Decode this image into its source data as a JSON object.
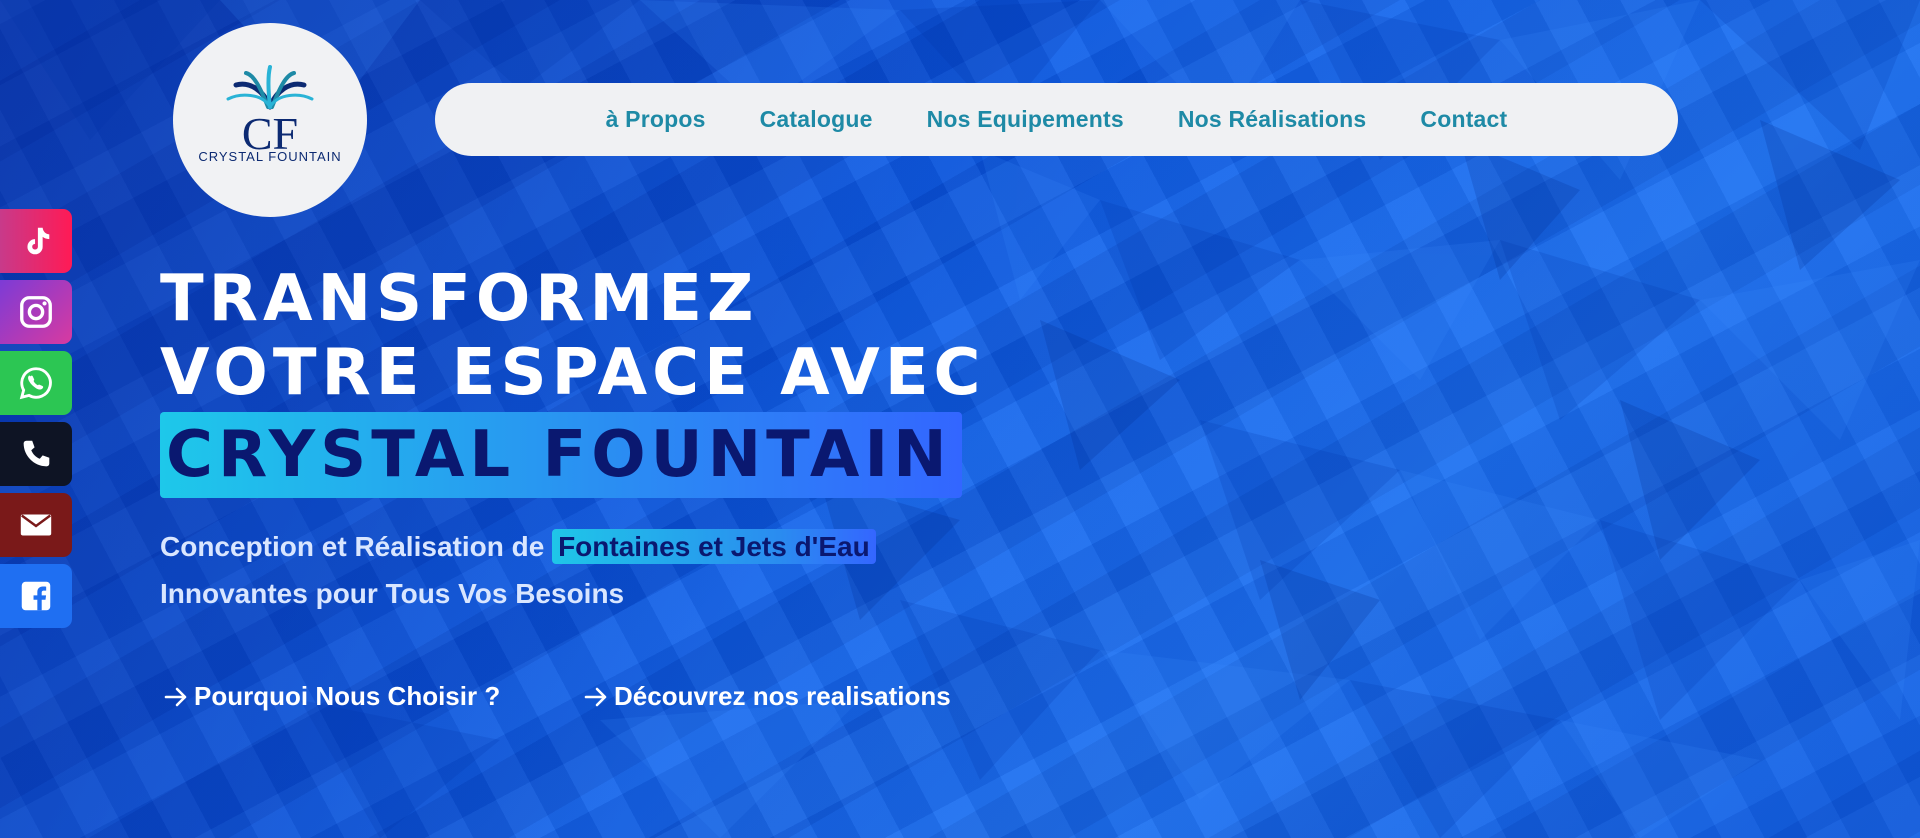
{
  "brand": {
    "logo_text": "CRYSTAL FOUNTAIN",
    "monogram": "CF",
    "colors": {
      "navy": "#0c2a72",
      "teal": "#1e8aa6"
    }
  },
  "nav": {
    "items": [
      {
        "label": "à Propos"
      },
      {
        "label": "Catalogue"
      },
      {
        "label": "Nos Equipements"
      },
      {
        "label": "Nos Réalisations"
      },
      {
        "label": "Contact"
      }
    ]
  },
  "social": [
    {
      "icon": "tiktok-icon",
      "color": "#e23a6b"
    },
    {
      "icon": "instagram-icon",
      "color": "#b83db3"
    },
    {
      "icon": "whatsapp-icon",
      "color": "#2cc653"
    },
    {
      "icon": "phone-icon",
      "color": "#0e1424"
    },
    {
      "icon": "email-icon",
      "color": "#7a1919"
    },
    {
      "icon": "facebook-icon",
      "color": "#1f6ff2"
    }
  ],
  "hero": {
    "title_line1": "TRANSFORMEZ",
    "title_line2": "VOTRE ESPACE AVEC",
    "title_highlight": "CRYSTAL FOUNTAIN",
    "subtitle_prefix": "Conception et Réalisation de ",
    "subtitle_highlight": "Fontaines et Jets d'Eau",
    "subtitle_line2": "Innovantes pour Tous Vos Besoins",
    "cta_primary": "Pourquoi Nous Choisir ?",
    "cta_secondary": "Découvrez nos realisations"
  }
}
